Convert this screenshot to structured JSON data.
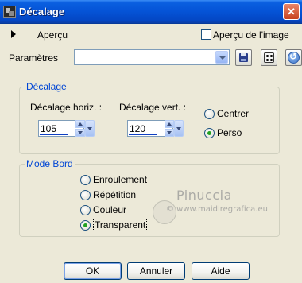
{
  "window": {
    "title": "Décalage",
    "close_glyph": "✕"
  },
  "preview": {
    "label": "Aperçu",
    "checkbox_label": "Aperçu de l'image",
    "checked": false
  },
  "params": {
    "label": "Paramètres",
    "preset_value": ""
  },
  "offset_group": {
    "title": "Décalage",
    "horiz_label": "Décalage horiz. :",
    "horiz_value": "105",
    "vert_label": "Décalage vert. :",
    "vert_value": "120",
    "center_label": "Centrer",
    "custom_label": "Perso",
    "selected": "Perso"
  },
  "edge_group": {
    "title": "Mode Bord",
    "options": [
      "Enroulement",
      "Répétition",
      "Couleur",
      "Transparent"
    ],
    "selected": "Transparent"
  },
  "watermark": {
    "title": "Pinuccia",
    "url": "© www.maidiregrafica.eu"
  },
  "buttons": {
    "ok": "OK",
    "cancel": "Annuler",
    "help": "Aide"
  },
  "colors": {
    "titlebar": "#0553d6",
    "dialog_bg": "#ece9d8",
    "group_title": "#0046d5",
    "radio_dot": "#21a121"
  }
}
